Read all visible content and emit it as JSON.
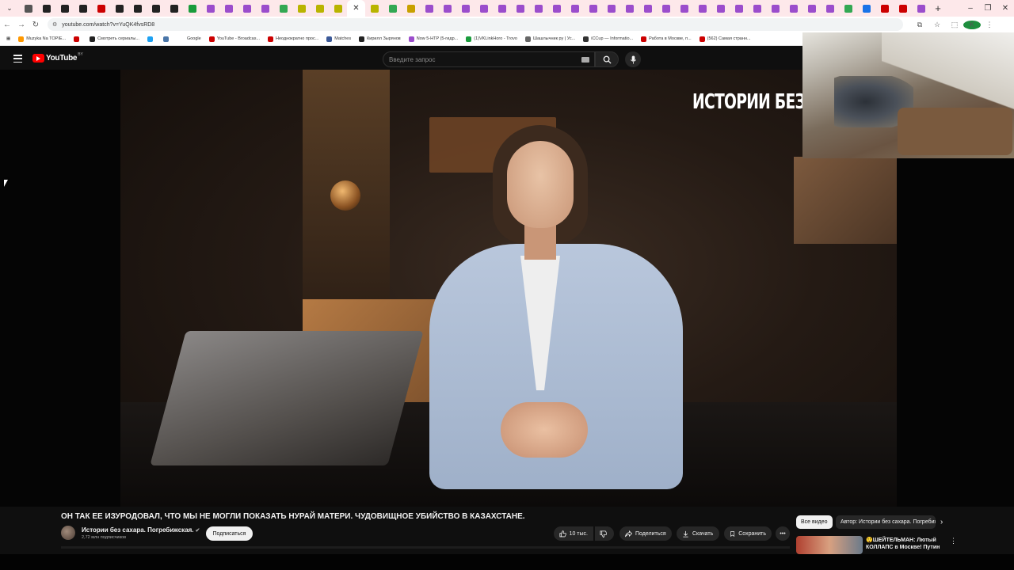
{
  "browser": {
    "tab_favicon_colors": [
      "#555555",
      "#222222",
      "#222222",
      "#222222",
      "#cc0000",
      "#222222",
      "#222222",
      "#222222",
      "#222222",
      "#1a9c3c",
      "#9b4dcc",
      "#9b4dcc",
      "#9b4dcc",
      "#9b4dcc",
      "#34a853",
      "#b9b400",
      "#b9b400",
      "#b9b400",
      "#ffffff",
      "#b9b400",
      "#34a853",
      "#c8a000",
      "#9b4dcc",
      "#9b4dcc",
      "#9b4dcc",
      "#9b4dcc",
      "#9b4dcc",
      "#9b4dcc",
      "#9b4dcc",
      "#9b4dcc",
      "#9b4dcc",
      "#9b4dcc",
      "#9b4dcc",
      "#9b4dcc",
      "#9b4dcc",
      "#9b4dcc",
      "#9b4dcc",
      "#9b4dcc",
      "#9b4dcc",
      "#9b4dcc",
      "#9b4dcc",
      "#9b4dcc",
      "#9b4dcc",
      "#9b4dcc",
      "#9b4dcc",
      "#34a853",
      "#1a73e8",
      "#cc0000",
      "#cc0000",
      "#9b4dcc"
    ],
    "active_tab_index": 18,
    "url": "youtube.com/watch?v=YuQK4fvsRD8",
    "profile_initial": "K",
    "bookmarks": [
      {
        "label": "Muzyka Na TOPIE...",
        "color": "#ff9800"
      },
      {
        "label": "",
        "color": "#cc0000"
      },
      {
        "label": "Смотреть сериалы...",
        "color": "#222222"
      },
      {
        "label": "",
        "color": "#1da1f2"
      },
      {
        "label": "",
        "color": "#4a76a8"
      },
      {
        "label": "Google",
        "color": "#ffffff"
      },
      {
        "label": "YouTube - Broadcas...",
        "color": "#cc0000"
      },
      {
        "label": "Неоднократно прос...",
        "color": "#cc0000"
      },
      {
        "label": "Matches",
        "color": "#3b5998"
      },
      {
        "label": "Кирилл Зырянов",
        "color": "#222222"
      },
      {
        "label": "Now 5-HTP (5-гидр...",
        "color": "#9b4dcc"
      },
      {
        "label": "(1)VKLinkHoro - Trovo",
        "color": "#1a9c3c"
      },
      {
        "label": "Шашлычник ру | Ус...",
        "color": "#666666"
      },
      {
        "label": "iCCup — Informatio...",
        "color": "#333333"
      },
      {
        "label": "Работа в Москве, п...",
        "color": "#cc0000"
      },
      {
        "label": "(562) Самая странн...",
        "color": "#cc0000"
      }
    ]
  },
  "youtube": {
    "region": "BY",
    "search_placeholder": "Введите запрос",
    "video_overlay_text": "ИСТОРИИ БЕЗ",
    "video_title": "ОН ТАК ЕЕ ИЗУРОДОВАЛ, ЧТО МЫ НЕ МОГЛИ ПОКАЗАТЬ НУРАЙ МАТЕРИ. ЧУДОВИЩНОЕ УБИЙСТВО В КАЗАХСТАНЕ.",
    "channel_name": "Истории без сахара. Погребижская.",
    "subscribers": "2,72 млн подписчиков",
    "subscribe_label": "Подписаться",
    "likes": "10 тыс.",
    "share_label": "Поделиться",
    "download_label": "Скачать",
    "save_label": "Сохранить",
    "chips": {
      "all": "Все видео",
      "author": "Автор: Истории без сахара. Погребижская."
    },
    "recommended": {
      "title": "😲ШЕЙТЕЛЬМАН: Лютый КОЛЛАПС в Москве! Путин ..."
    }
  }
}
